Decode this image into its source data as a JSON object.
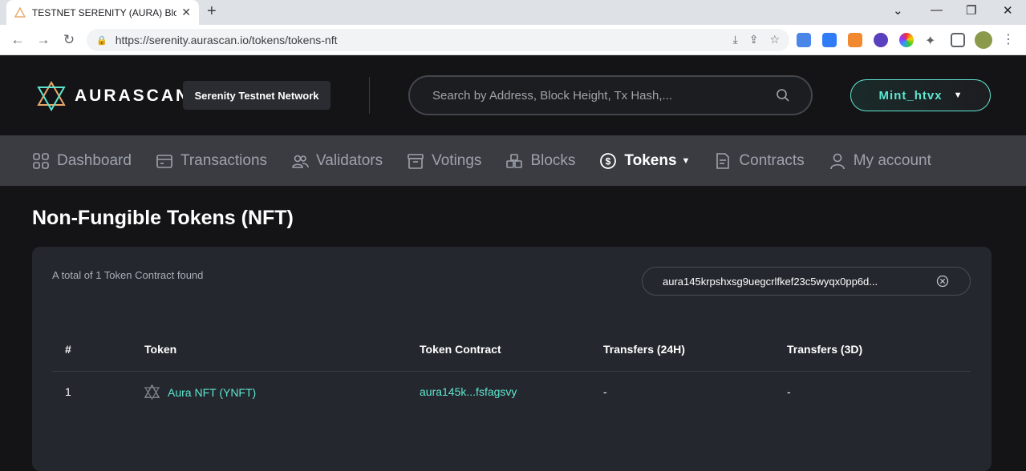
{
  "browser": {
    "tab_title": "TESTNET SERENITY (AURA) Block",
    "url": "https://serenity.aurascan.io/tokens/tokens-nft"
  },
  "header": {
    "brand": "AURASCAN",
    "network": "Serenity Testnet Network",
    "search_placeholder": "Search by Address, Block Height, Tx Hash,...",
    "account": "Mint_htvx"
  },
  "nav": {
    "items": [
      {
        "label": "Dashboard",
        "icon": "dashboard-icon"
      },
      {
        "label": "Transactions",
        "icon": "transactions-icon"
      },
      {
        "label": "Validators",
        "icon": "validators-icon"
      },
      {
        "label": "Votings",
        "icon": "votings-icon"
      },
      {
        "label": "Blocks",
        "icon": "blocks-icon"
      },
      {
        "label": "Tokens",
        "icon": "tokens-icon",
        "active": true
      },
      {
        "label": "Contracts",
        "icon": "contracts-icon"
      },
      {
        "label": "My account",
        "icon": "account-icon"
      }
    ]
  },
  "page": {
    "title": "Non-Fungible Tokens (NFT)",
    "count_text": "A total of 1 Token Contract found",
    "filter_value": "aura145krpshxsg9uegcrlfkef23c5wyqx0pp6d..."
  },
  "table": {
    "headers": [
      "#",
      "Token",
      "Token Contract",
      "Transfers (24H)",
      "Transfers (3D)"
    ],
    "rows": [
      {
        "index": "1",
        "token": "Aura NFT (YNFT)",
        "contract": "aura145k...fsfagsvy",
        "transfers_24h": "-",
        "transfers_3d": "-"
      }
    ]
  },
  "colors": {
    "accent": "#5ee6d0",
    "background": "#141416",
    "nav_bg": "#3a3c42",
    "card_bg": "#24272d"
  }
}
